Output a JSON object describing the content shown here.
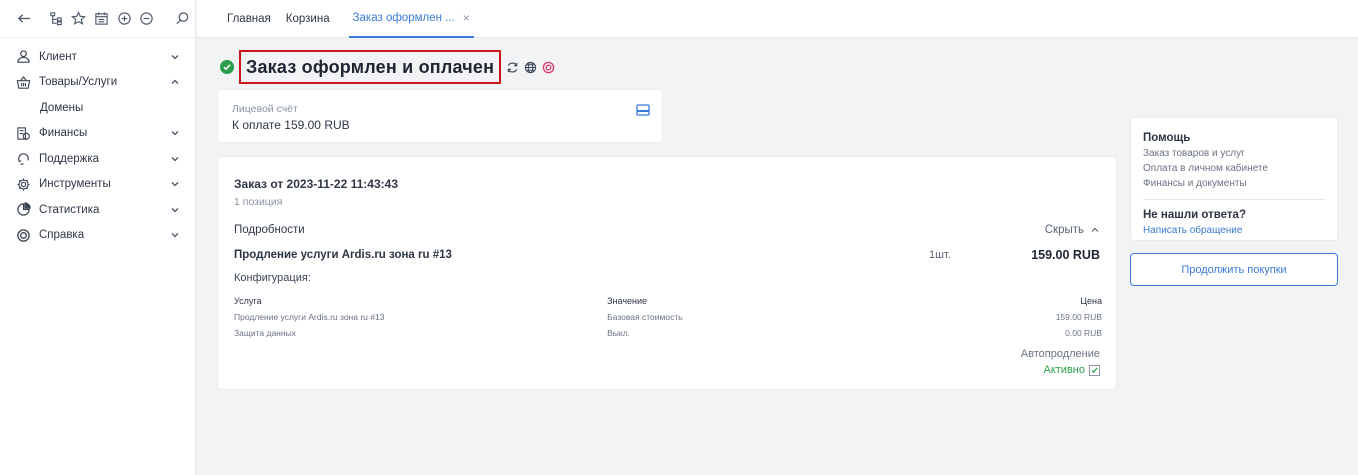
{
  "sidebar": {
    "items": [
      {
        "label": "Клиент",
        "icon": "user-icon",
        "expanded": false
      },
      {
        "label": "Товары/Услуги",
        "icon": "basket-icon",
        "expanded": true
      },
      {
        "label": "Домены",
        "sub": true
      },
      {
        "label": "Финансы",
        "icon": "finance-icon",
        "expanded": false
      },
      {
        "label": "Поддержка",
        "icon": "support-icon",
        "expanded": false
      },
      {
        "label": "Инструменты",
        "icon": "gear-icon",
        "expanded": false
      },
      {
        "label": "Статистика",
        "icon": "chart-icon",
        "expanded": false
      },
      {
        "label": "Справка",
        "icon": "help-icon",
        "expanded": false
      }
    ]
  },
  "tabs": {
    "home": "Главная",
    "cart": "Корзина",
    "order": "Заказ оформлен ...",
    "close": "×"
  },
  "page": {
    "title": "Заказ оформлен и оплачен"
  },
  "account": {
    "label": "Лицевой счёт",
    "value": "К оплате 159.00 RUB"
  },
  "order": {
    "title": "Заказ от 2023-11-22 11:43:43",
    "positions": "1 позиция",
    "details_label": "Подробности",
    "hide_label": "Скрыть",
    "product": "Продление услуги Ardis.ru зона ru #13",
    "qty": "1шт.",
    "price": "159.00 RUB",
    "config_label": "Конфигурация:",
    "table": {
      "headers": [
        "Услуга",
        "Значение",
        "Цена"
      ],
      "rows": [
        [
          "Продление услуги Ardis.ru зона ru #13",
          "Базовая стоимость",
          "159.00 RUB"
        ],
        [
          "Защита данных",
          "Выкл.",
          "0.00 RUB"
        ]
      ]
    },
    "autorenew_label": "Автопродление",
    "autorenew_status": "Активно"
  },
  "help": {
    "title": "Помощь",
    "links": [
      "Заказ товаров и услуг",
      "Оплата в личном кабинете",
      "Финансы и документы"
    ],
    "question": "Не нашли ответа?",
    "write": "Написать обращение"
  },
  "continue_label": "Продолжить покупки",
  "colors": {
    "accent": "#3a7bd5",
    "success": "#2a9d4a",
    "highlight": "#c8151b"
  }
}
